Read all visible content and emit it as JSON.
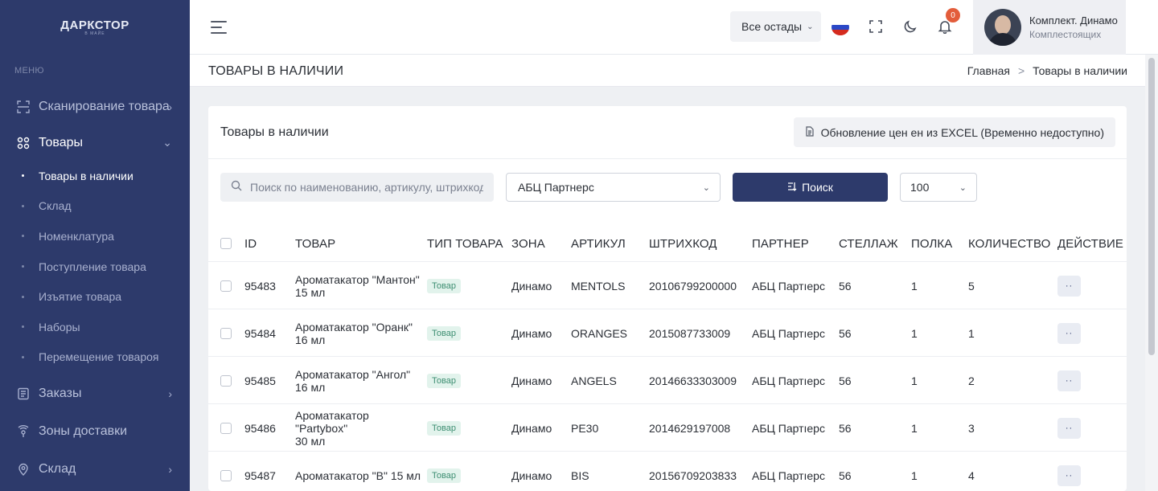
{
  "sidebar": {
    "brand": "ДАРКСТОР",
    "brand_sub": "В МАЙЕ",
    "menu_caption": "МЕНЮ",
    "items": [
      {
        "label": "Сканирование товара",
        "icon": "scan-icon"
      },
      {
        "label": "Товары",
        "icon": "grid-icon"
      },
      {
        "label": "Заказы",
        "icon": "receipt-icon"
      },
      {
        "label": "Зоны доставки",
        "icon": "delivery-zone-icon"
      },
      {
        "label": "Склад",
        "icon": "location-pin-icon"
      }
    ],
    "sub_items": [
      {
        "label": "Товары в наличии",
        "active": true
      },
      {
        "label": "Склад"
      },
      {
        "label": "Номенклатура"
      },
      {
        "label": "Поступление товара"
      },
      {
        "label": "Изъятие товара"
      },
      {
        "label": "Наборы"
      },
      {
        "label": "Перемещение товароя"
      }
    ]
  },
  "topbar": {
    "warehouse_select": "Все остады",
    "notifications_count": "0",
    "user_name": "Комплект. Динамо",
    "user_role": "Комплестоящих"
  },
  "titlebar": {
    "title": "ТОВАРЫ В НАЛИЧИИ",
    "breadcrumb_home": "Главная",
    "breadcrumb_sep": ">",
    "breadcrumb_current": "Товары в наличии"
  },
  "card": {
    "title": "Товары в наличии",
    "excel_button": "Обновление цен ен из EXCEL (Временно недоступно)",
    "search_placeholder": "Поиск по наименованию, артикулу, штрихкоду",
    "partner_select": "АБЦ Партнерс",
    "search_button": "Поиск",
    "count_select": "100"
  },
  "table": {
    "headers": {
      "id": "ID",
      "product": "ТОВАР",
      "type": "ТИП ТОВАРА",
      "zone": "ЗОНА",
      "sku": "АРТИКУЛ",
      "barcode": "ШТРИХКОД",
      "partner": "ПАРТНЕР",
      "rack": "СТЕЛЛАЖ",
      "shelf": "ПОЛКА",
      "qty": "КОЛИЧЕСТВО",
      "action": "ДЕЙСТВИЕ"
    },
    "rows": [
      {
        "id": "95483",
        "name_1": "Ароматакатор \"Мантон\"",
        "name_2": "15 мл",
        "type": "Товар",
        "zone": "Динамо",
        "sku": "MENTOLS",
        "barcode": "20106799200000",
        "partner": "АБЦ Партıерс",
        "rack": "56",
        "shelf": "1",
        "qty": "5"
      },
      {
        "id": "95484",
        "name_1": "Ароматакатор \"Оранк\"",
        "name_2": "16 мл",
        "type": "Товар",
        "zone": "Динамо",
        "sku": "ORANGES",
        "barcode": "2015087733009",
        "partner": "АБЦ Партıерс",
        "rack": "56",
        "shelf": "1",
        "qty": "1"
      },
      {
        "id": "95485",
        "name_1": "Ароматакатор \"Ангол\"",
        "name_2": "16 мл",
        "type": "Товар",
        "zone": "Динамо",
        "sku": "ANGELS",
        "barcode": "20146633303009",
        "partner": "АБЦ Партıерс",
        "rack": "56",
        "shelf": "1",
        "qty": "2"
      },
      {
        "id": "95486",
        "name_1": "Ароматакатор \"Partybox\"",
        "name_2": "30 мл",
        "type": "Товар",
        "zone": "Динамо",
        "sku": "PE30",
        "barcode": "2014629197008",
        "partner": "АБЦ Партıерс",
        "rack": "56",
        "shelf": "1",
        "qty": "3"
      },
      {
        "id": "95487",
        "name_1": "Ароматакатор \"В\" 15 мл",
        "name_2": "",
        "type": "Товар",
        "zone": "Динамо",
        "sku": "BIS",
        "barcode": "20156709203833",
        "partner": "АБЦ Партıерс",
        "rack": "56",
        "shelf": "1",
        "qty": "4"
      }
    ],
    "action_label": "··"
  },
  "colors": {
    "sidebar_bg": "#2d3a6b",
    "primary": "#2d3a6b",
    "badge": "#e35d3b",
    "pill_text": "#3f8f73",
    "pill_bg": "#e2f3ec"
  }
}
